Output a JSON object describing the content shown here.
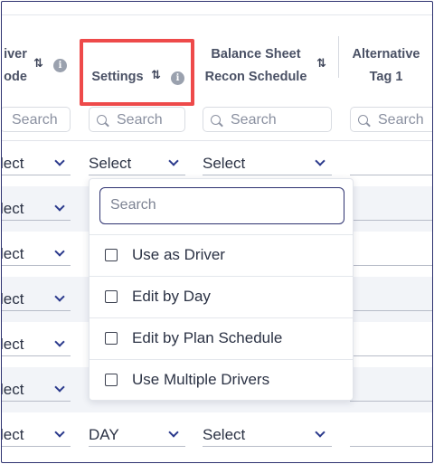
{
  "columns": {
    "driver_mode": {
      "line1": "iver",
      "line2": "ode"
    },
    "settings": {
      "label": "Settings"
    },
    "balance_sheet": {
      "line1": "Balance Sheet",
      "line2": "Recon Schedule"
    },
    "alt_tag": {
      "line1": "Alternative",
      "line2": "Tag 1"
    }
  },
  "icons": {
    "sort": "sort-arrows-icon",
    "info": "info-icon",
    "search": "search-icon",
    "chevron": "chevron-down-icon"
  },
  "info_glyph": "i",
  "search_placeholder": "Search",
  "rows": [
    {
      "col1": "lect",
      "col2": "Select",
      "col3": "Select"
    },
    {
      "col1": "lect"
    },
    {
      "col1": "lect"
    },
    {
      "col1": "lect"
    },
    {
      "col1": "lect"
    },
    {
      "col1": "lect"
    },
    {
      "col1": "lect",
      "col2": "DAY",
      "col3": "Select"
    }
  ],
  "dropdown": {
    "search_placeholder": "Search",
    "options": [
      "Use as Driver",
      "Edit by Day",
      "Edit by Plan Schedule",
      "Use Multiple Drivers"
    ]
  },
  "colors": {
    "highlight": "#ee4a4a",
    "accent": "#2e3270",
    "chevron": "#2b3a8c"
  }
}
